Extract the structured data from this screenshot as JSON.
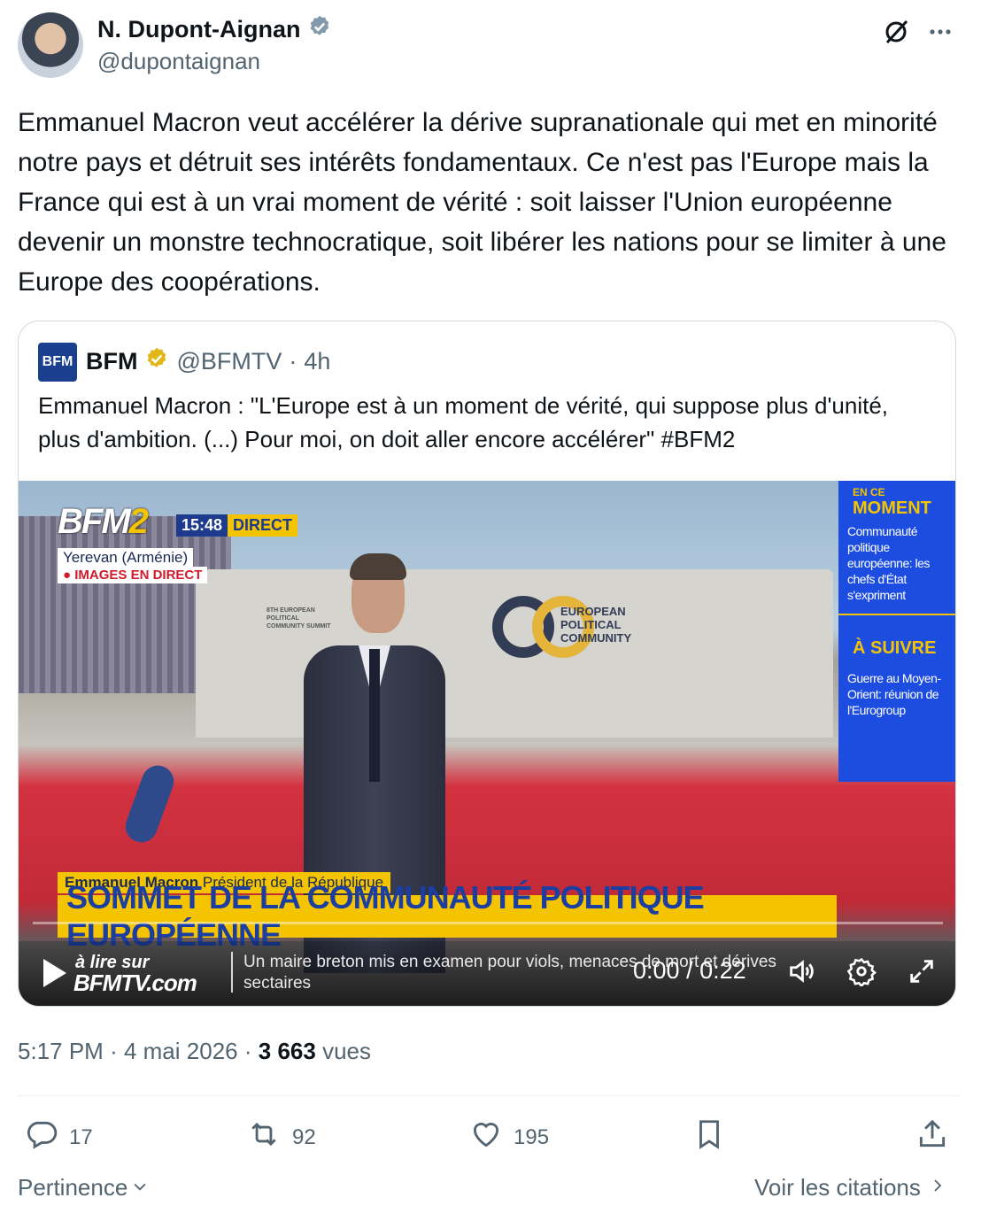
{
  "author": {
    "name": "N. Dupont-Aignan",
    "handle": "@dupontaignan",
    "verified_icon": "verified-badge-icon"
  },
  "header_icons": [
    "grok-icon",
    "more-icon"
  ],
  "tweet": {
    "text": "Emmanuel Macron veut accélérer la dérive supranationale qui met en minorité notre pays et détruit ses intérêts fondamentaux. Ce n'est pas l'Europe mais la France qui est à un vrai moment de vérité : soit laisser l'Union européenne devenir un monstre technocratique, soit libérer les nations pour se limiter à une Europe des coopérations."
  },
  "quote": {
    "logo_text": "BFM",
    "name": "BFM",
    "handle": "@BFMTV",
    "separator": "·",
    "age": "4h",
    "text": "Emmanuel Macron : \"L'Europe est à un moment de vérité, qui suppose plus d'unité, plus d'ambition. (...) Pour moi, on doit aller encore accélérer\" #BFM2",
    "video": {
      "channel": "BFM",
      "channel_num": "2",
      "clock": "15:48",
      "live_label": "DIRECT",
      "location": "Yerevan (Arménie)",
      "live_images": "● IMAGES EN DIRECT",
      "sign_left": "8TH EUROPEAN POLITICAL COMMUNITY SUMMIT",
      "sign_main": "EUROPEAN POLITICAL COMMUNITY",
      "side_now_small": "EN CE",
      "side_now": "MOMENT",
      "side_now_text": "Communauté politique européenne: les chefs d'État s'expriment",
      "side_next": "À SUIVRE",
      "side_next_text": "Guerre au Moyen-Orient: réunion de l'Eurogroup",
      "speaker_name": "Emmanuel Macron",
      "speaker_title": "Président de la République",
      "headline": "SOMMET DE LA COMMUNAUTÉ POLITIQUE EUROPÉENNE",
      "promo_small": "à lire sur",
      "promo_site": "BFMTV.com",
      "ticker": "Un maire breton mis en examen pour viols, menaces de mort et dérives sectaires",
      "current_time": "0:00",
      "time_sep": "/",
      "duration": "0:22",
      "progress": 0
    }
  },
  "meta": {
    "time": "5:17 PM",
    "sep1": "·",
    "date": "4 mai 2026",
    "sep2": "·",
    "views_count": "3 663",
    "views_label": "vues"
  },
  "actions": {
    "replies": "17",
    "reposts": "92",
    "likes": "195"
  },
  "footer": {
    "sort_label": "Pertinence",
    "quotes_label": "Voir les citations"
  },
  "colors": {
    "text": "#0f1419",
    "secondary": "#536471",
    "verified_blue": "#1d9bf0",
    "gold_badge": "#e2b719",
    "bfm_blue": "#1c4de0",
    "bfm_yellow": "#f4c400"
  }
}
